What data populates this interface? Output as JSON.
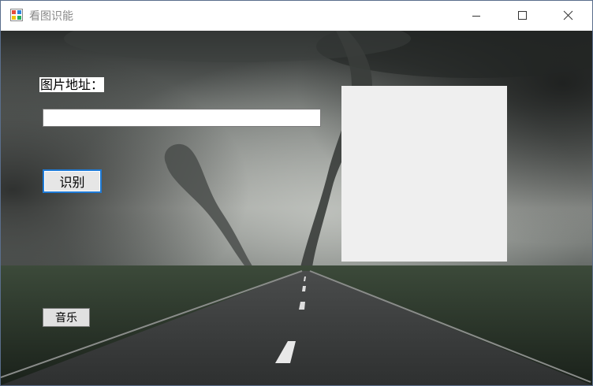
{
  "window": {
    "title": "看图识能",
    "icon": "app-window-icon",
    "controls": [
      "minimize-icon",
      "maximize-icon",
      "close-icon"
    ]
  },
  "form": {
    "address_label": "图片地址：",
    "address_value": "",
    "recognize_button": "识别",
    "music_button": "音乐"
  },
  "colors": {
    "focus_border": "#1e7ad6",
    "picture_box": "#efefef",
    "button_face": "#e1e1e1"
  }
}
